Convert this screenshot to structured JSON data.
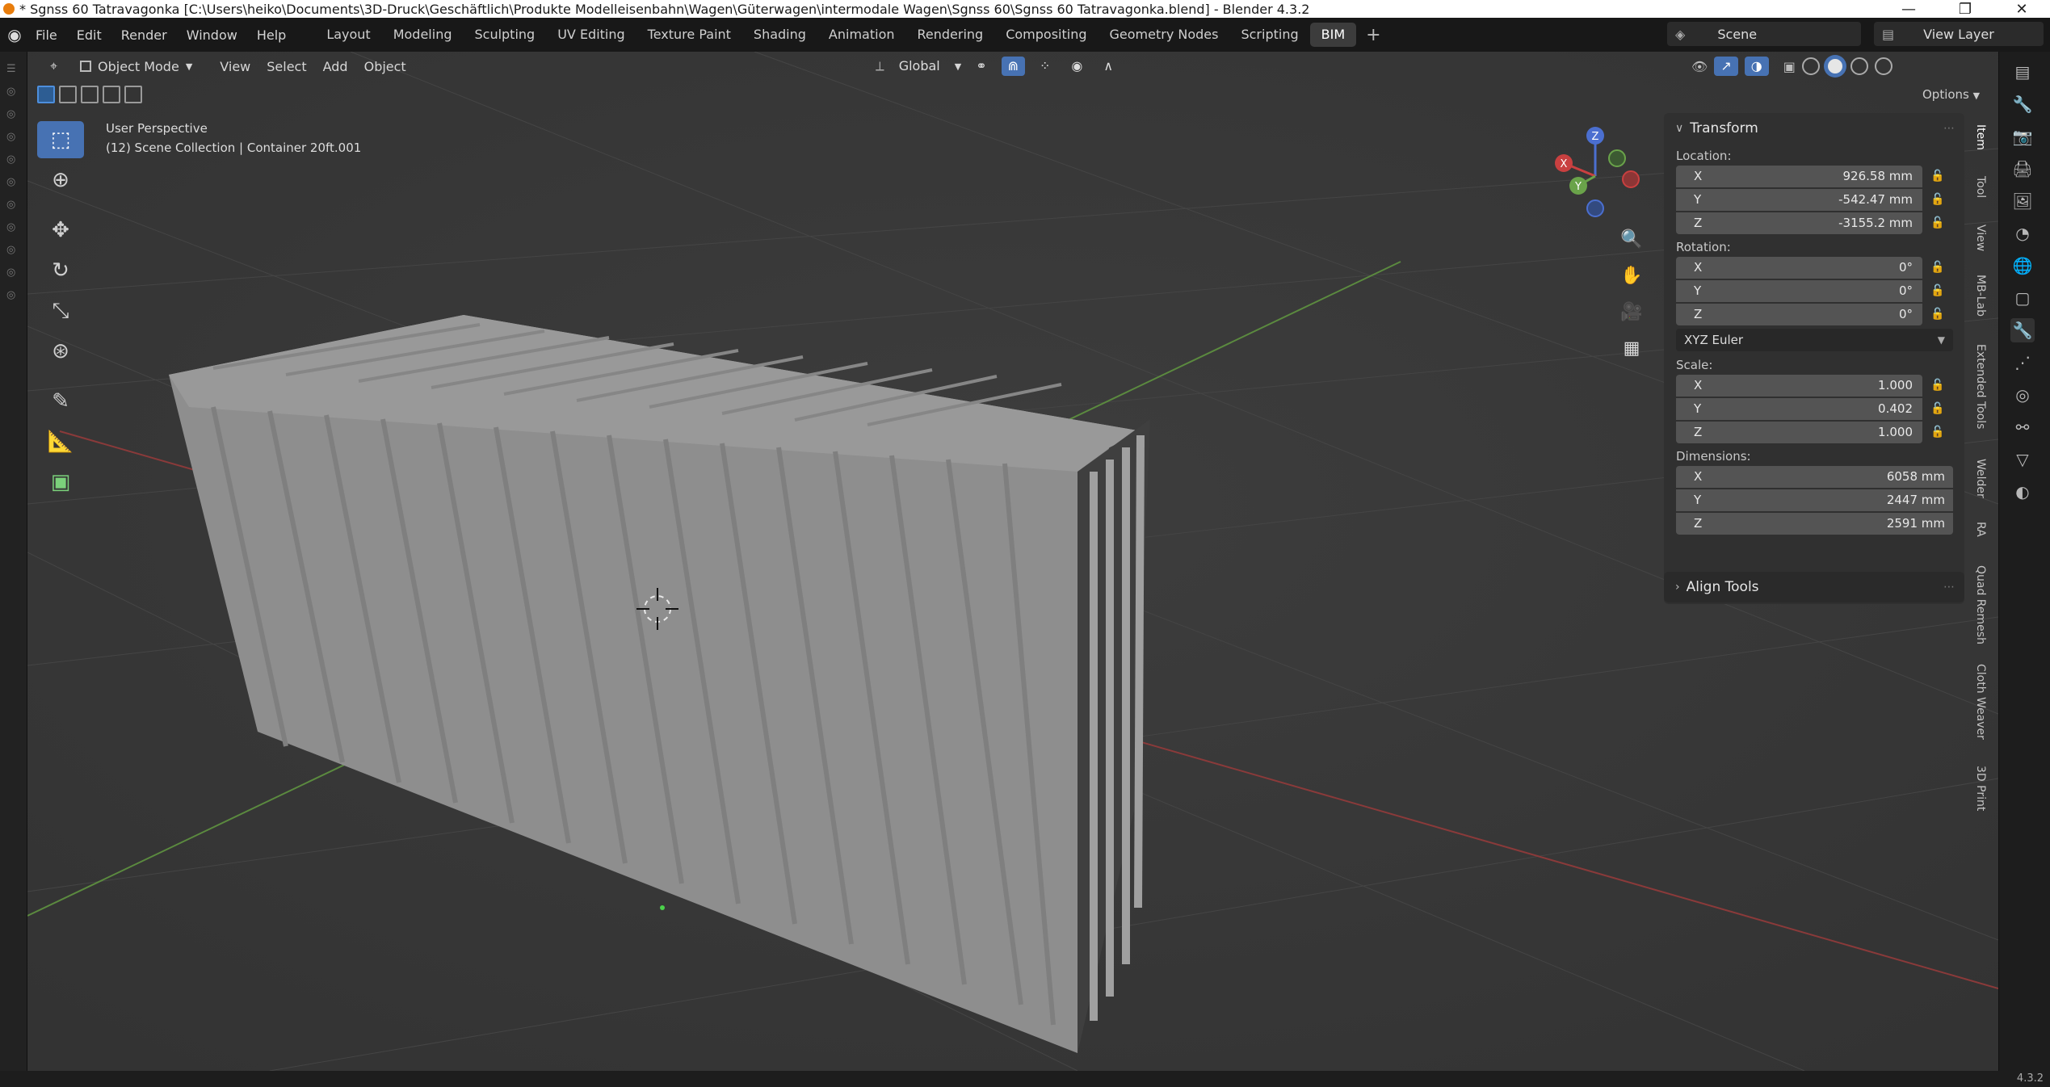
{
  "window": {
    "title": "* Sgnss 60 Tatravagonka [C:\\Users\\heiko\\Documents\\3D-Druck\\Geschäftlich\\Produkte Modelleisenbahn\\Wagen\\Güterwagen\\intermodale Wagen\\Sgnss 60\\Sgnss 60 Tatravagonka.blend] - Blender 4.3.2",
    "controls": [
      "—",
      "❐",
      "✕"
    ]
  },
  "menu": [
    "File",
    "Edit",
    "Render",
    "Window",
    "Help"
  ],
  "workspaces": [
    "Layout",
    "Modeling",
    "Sculpting",
    "UV Editing",
    "Texture Paint",
    "Shading",
    "Animation",
    "Rendering",
    "Compositing",
    "Geometry Nodes",
    "Scripting",
    "BIM"
  ],
  "active_workspace": "BIM",
  "scene": "Scene",
  "view_layer": "View Layer",
  "viewport_header": {
    "mode": "Object Mode",
    "menus": [
      "View",
      "Select",
      "Add",
      "Object"
    ],
    "transform_orientation": "Global",
    "options": "Options"
  },
  "viewport": {
    "perspective": "User Perspective",
    "collection_info": "(12) Scene Collection | Container 20ft.001"
  },
  "gizmo": {
    "x": "X",
    "y": "Y",
    "z": "Z"
  },
  "transform": {
    "header": "Transform",
    "location_label": "Location:",
    "location": [
      {
        "axis": "X",
        "value": "926.58 mm"
      },
      {
        "axis": "Y",
        "value": "-542.47 mm"
      },
      {
        "axis": "Z",
        "value": "-3155.2 mm"
      }
    ],
    "rotation_label": "Rotation:",
    "rotation": [
      {
        "axis": "X",
        "value": "0°"
      },
      {
        "axis": "Y",
        "value": "0°"
      },
      {
        "axis": "Z",
        "value": "0°"
      }
    ],
    "rotation_mode": "XYZ Euler",
    "scale_label": "Scale:",
    "scale": [
      {
        "axis": "X",
        "value": "1.000"
      },
      {
        "axis": "Y",
        "value": "0.402"
      },
      {
        "axis": "Z",
        "value": "1.000"
      }
    ],
    "dimensions_label": "Dimensions:",
    "dimensions": [
      {
        "axis": "X",
        "value": "6058 mm"
      },
      {
        "axis": "Y",
        "value": "2447 mm"
      },
      {
        "axis": "Z",
        "value": "2591 mm"
      }
    ]
  },
  "align_tools": "Align Tools",
  "side_tabs": [
    "Item",
    "Tool",
    "View",
    "MB-Lab",
    "Extended Tools",
    "Welder",
    "RA",
    "Quad Remesh",
    "Cloth Weaver",
    "3D Print"
  ],
  "version": "4.3.2",
  "colors": {
    "accent": "#4772b3",
    "x_axis": "#c94040",
    "y_axis": "#6aa34a",
    "z_axis": "#4b6fd0"
  }
}
